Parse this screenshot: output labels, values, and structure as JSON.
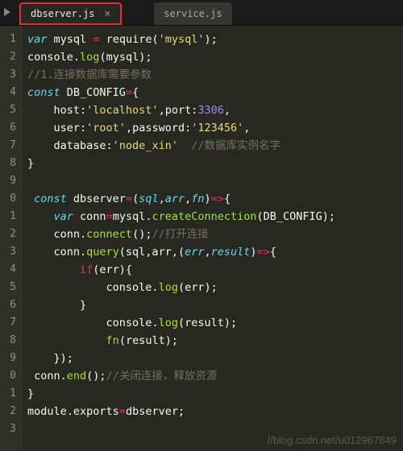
{
  "tabs": {
    "active": {
      "label": "dbserver.js"
    },
    "inactive": {
      "label": "service.js"
    }
  },
  "gutter": [
    "1",
    "2",
    "3",
    "4",
    "5",
    "6",
    "7",
    "8",
    "9",
    "0",
    "1",
    "2",
    "3",
    "4",
    "5",
    "6",
    "7",
    "8",
    "9",
    "0",
    "1",
    "2",
    "3"
  ],
  "code": {
    "l1": {
      "a": "var",
      "b": " mysql ",
      "c": "=",
      "d": " require",
      "e": "(",
      "f": "'mysql'",
      "g": ");"
    },
    "l2": {
      "a": "console",
      "b": ".",
      "c": "log",
      "d": "(mysql);"
    },
    "l3": {
      "a": "//1.连接数据库需要参数"
    },
    "l4": {
      "a": "const",
      "b": " DB_CONFIG",
      "c": "=",
      "d": "{"
    },
    "l5": {
      "a": "    host:",
      "b": "'localhost'",
      "c": ",port:",
      "d": "3306",
      "e": ","
    },
    "l6": {
      "a": "    user:",
      "b": "'root'",
      "c": ",password:",
      "d": "'123456'",
      "e": ","
    },
    "l7": {
      "a": "    database:",
      "b": "'node_xin'",
      "c": "  ",
      "d": "//数据库实例名字"
    },
    "l8": {
      "a": "}"
    },
    "l10": {
      "a": " const",
      "b": " dbserver",
      "c": "=",
      "d": "(",
      "e": "sql",
      "f": ",",
      "g": "arr",
      "h": ",",
      "i": "fn",
      "j": ")",
      "k": "=>",
      "l": "{"
    },
    "l11": {
      "a": "    var",
      "b": " conn",
      "c": "=",
      "d": "mysql.",
      "e": "createConnection",
      "f": "(DB_CONFIG);"
    },
    "l12": {
      "a": "    conn.",
      "b": "connect",
      "c": "();",
      "d": "//打开连接"
    },
    "l13": {
      "a": "    conn.",
      "b": "query",
      "c": "(sql,arr,(",
      "d": "err",
      "e": ",",
      "f": "result",
      "g": ")",
      "h": "=>",
      "i": "{"
    },
    "l14": {
      "a": "        if",
      "b": "(err){"
    },
    "l15": {
      "a": "            console.",
      "b": "log",
      "c": "(err);"
    },
    "l16": {
      "a": "        }"
    },
    "l17": {
      "a": "            console.",
      "b": "log",
      "c": "(result);"
    },
    "l18": {
      "a": "            ",
      "b": "fn",
      "c": "(result);"
    },
    "l19": {
      "a": "    });"
    },
    "l20": {
      "a": " conn.",
      "b": "end",
      "c": "();",
      "d": "//关闭连接，释放资源"
    },
    "l21": {
      "a": "}"
    },
    "l22": {
      "a": "module.exports",
      "b": "=",
      "c": "dbserver;"
    }
  },
  "watermark": "//blog.csdn.net/u012967849"
}
